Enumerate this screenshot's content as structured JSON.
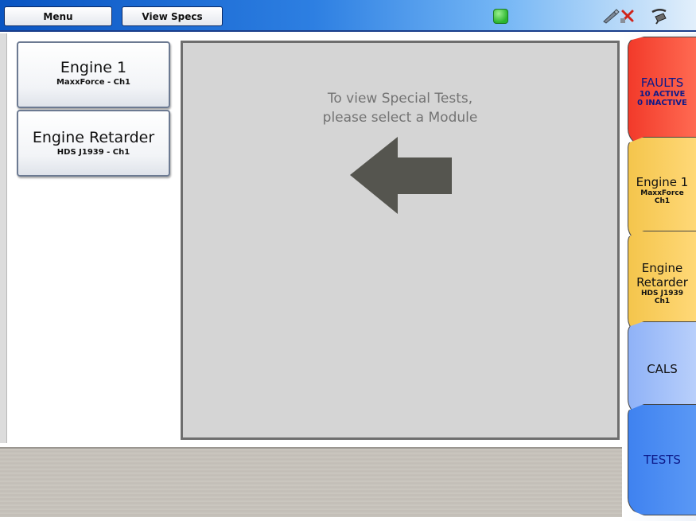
{
  "toolbar": {
    "menu_label": "Menu",
    "view_specs_label": "View Specs",
    "status_icon": "connection-status-led",
    "icons": [
      "stylus-icon",
      "close-icon",
      "connector-plug-icon"
    ]
  },
  "modules": [
    {
      "title": "Engine 1",
      "subtitle": "MaxxForce - Ch1"
    },
    {
      "title": "Engine Retarder",
      "subtitle": "HDS J1939 - Ch1"
    }
  ],
  "panel": {
    "message_line1": "To view Special Tests,",
    "message_line2": "please select a Module"
  },
  "tabs": {
    "faults": {
      "title": "FAULTS",
      "active": "10 ACTIVE",
      "inactive": "0 INACTIVE"
    },
    "engine1": {
      "title": "Engine 1",
      "line1": "MaxxForce",
      "line2": "Ch1"
    },
    "retarder": {
      "title_line1": "Engine",
      "title_line2": "Retarder",
      "line1": "HDS J1939",
      "line2": "Ch1"
    },
    "cals": {
      "title": "CALS"
    },
    "tests": {
      "title": "TESTS",
      "selected": true
    }
  },
  "colors": {
    "faults_tab": "#f23a2a",
    "module_tab": "#f4c54c",
    "cals_tab": "#8fb2f7",
    "tests_tab": "#3f82f0",
    "panel": "#d5d5d5",
    "arrow": "#55554f"
  }
}
